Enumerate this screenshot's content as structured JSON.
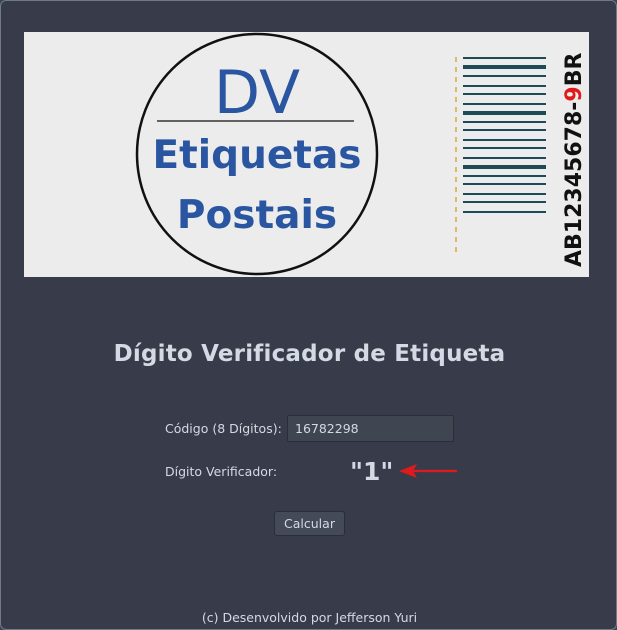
{
  "banner": {
    "logo_dv": "DV",
    "logo_line1": "Etiquetas",
    "logo_line2": "Postais",
    "sample_code": "AB12345678-",
    "sample_digit": "9",
    "sample_suffix": "BR"
  },
  "title": "Dígito Verificador de Etiqueta",
  "form": {
    "code_label": "Código (8 Dígitos):",
    "code_value": "16782298",
    "digit_label": "Dígito Verificador:",
    "digit_result": "\"1\"",
    "calc_button": "Calcular"
  },
  "footer": "(c) Desenvolvido por Jefferson Yuri",
  "colors": {
    "window_bg": "#383c4a",
    "text": "#d3dae3",
    "logo_blue": "#2a55a0",
    "barcode": "#1d4a57",
    "arrow": "#e0191d",
    "digit_red": "#e0191d"
  }
}
